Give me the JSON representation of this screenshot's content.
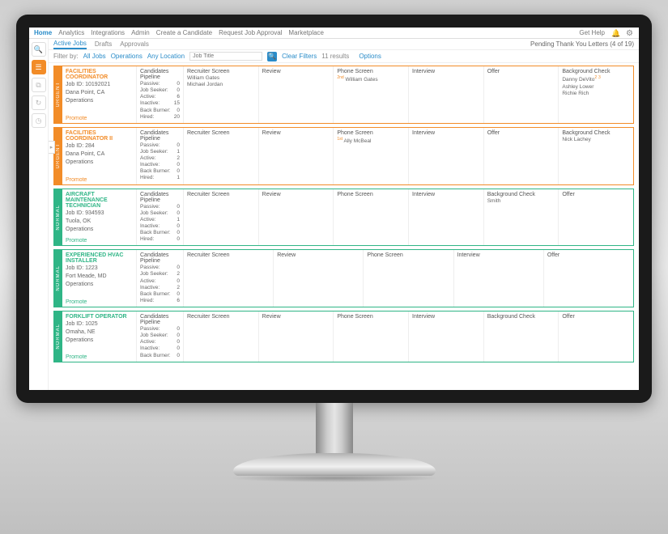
{
  "nav": {
    "items": [
      "Home",
      "Analytics",
      "Integrations",
      "Admin",
      "Create a Candidate",
      "Request Job Approval",
      "Marketplace"
    ],
    "active_index": 0,
    "get_help": "Get Help"
  },
  "rail": {
    "icons": [
      "search-icon",
      "list-icon",
      "copy-icon",
      "history-icon",
      "clock-icon"
    ]
  },
  "tabs": {
    "items": [
      "Active Jobs",
      "Drafts",
      "Approvals"
    ],
    "active_index": 0,
    "pending_text": "Pending Thank You Letters (4 of 19)"
  },
  "filter": {
    "label": "Filter by:",
    "all_jobs": "All Jobs",
    "operations": "Operations",
    "any_location": "Any Location",
    "placeholder": "Job Title",
    "clear_filters": "Clear Filters",
    "results": "11 results",
    "options": "Options"
  },
  "pipeline_labels": [
    "Passive:",
    "Job Seeker:",
    "Active:",
    "Inactive:",
    "Back Burner:",
    "Hired:"
  ],
  "pipeline_header": "Candidates Pipeline",
  "promote_label": "Promote",
  "jobs": [
    {
      "priority": "URGENT",
      "title": "FACILITIES COORDINATOR",
      "job_id": "Job ID: 10192021",
      "location": "Dana Point, CA",
      "department": "Operations",
      "pipeline": [
        0,
        0,
        6,
        15,
        0,
        20
      ],
      "stages": [
        "Recruiter Screen",
        "Review",
        "Phone Screen",
        "Interview",
        "Offer",
        "Background Check"
      ],
      "stage_candidates": [
        [
          "William Gates",
          "Michael Jordan"
        ],
        [],
        [
          "2nd William Gates"
        ],
        [],
        [],
        [
          "Danny DeVito² ³",
          "Ashley Lower",
          "Richie Rich"
        ]
      ]
    },
    {
      "priority": "URGENT",
      "title": "FACILITIES COORDINATOR II",
      "job_id": "Job ID: 284",
      "location": "Dana Point, CA",
      "department": "Operations",
      "pipeline": [
        0,
        1,
        2,
        0,
        0,
        1
      ],
      "stages": [
        "Recruiter Screen",
        "Review",
        "Phone Screen",
        "Interview",
        "Offer",
        "Background Check"
      ],
      "stage_candidates": [
        [],
        [],
        [
          "1st Ally McBeal"
        ],
        [],
        [],
        [
          "Nick Lachey"
        ]
      ]
    },
    {
      "priority": "NORMAL",
      "title": "AIRCRAFT MAINTENANCE TECHNICIAN",
      "job_id": "Job ID: 934593",
      "location": "Tuola, OK",
      "department": "Operations",
      "pipeline": [
        0,
        0,
        1,
        0,
        0,
        0
      ],
      "stages": [
        "Recruiter Screen",
        "Review",
        "Phone Screen",
        "Interview",
        "Background Check",
        "Offer"
      ],
      "stage_candidates": [
        [],
        [],
        [],
        [],
        [
          "Smith"
        ],
        []
      ]
    },
    {
      "priority": "NORMAL",
      "title": "EXPERIENCED HVAC INSTALLER",
      "job_id": "Job ID: 1223",
      "location": "Fort Meade, MD",
      "department": "Operations",
      "pipeline": [
        0,
        2,
        0,
        2,
        0,
        6
      ],
      "stages": [
        "Recruiter Screen",
        "Review",
        "Phone Screen",
        "Interview",
        "Offer"
      ],
      "stage_candidates": [
        [],
        [],
        [],
        [],
        []
      ]
    },
    {
      "priority": "NORMAL",
      "title": "FORKLIFT OPERATOR",
      "job_id": "Job ID: 1025",
      "location": "Omaha, NE",
      "department": "Operations",
      "pipeline": [
        0,
        0,
        0,
        0,
        0,
        null
      ],
      "stages": [
        "Recruiter Screen",
        "Review",
        "Phone Screen",
        "Interview",
        "Background Check",
        "Offer"
      ],
      "stage_candidates": [
        [],
        [],
        [],
        [],
        [],
        []
      ]
    }
  ]
}
